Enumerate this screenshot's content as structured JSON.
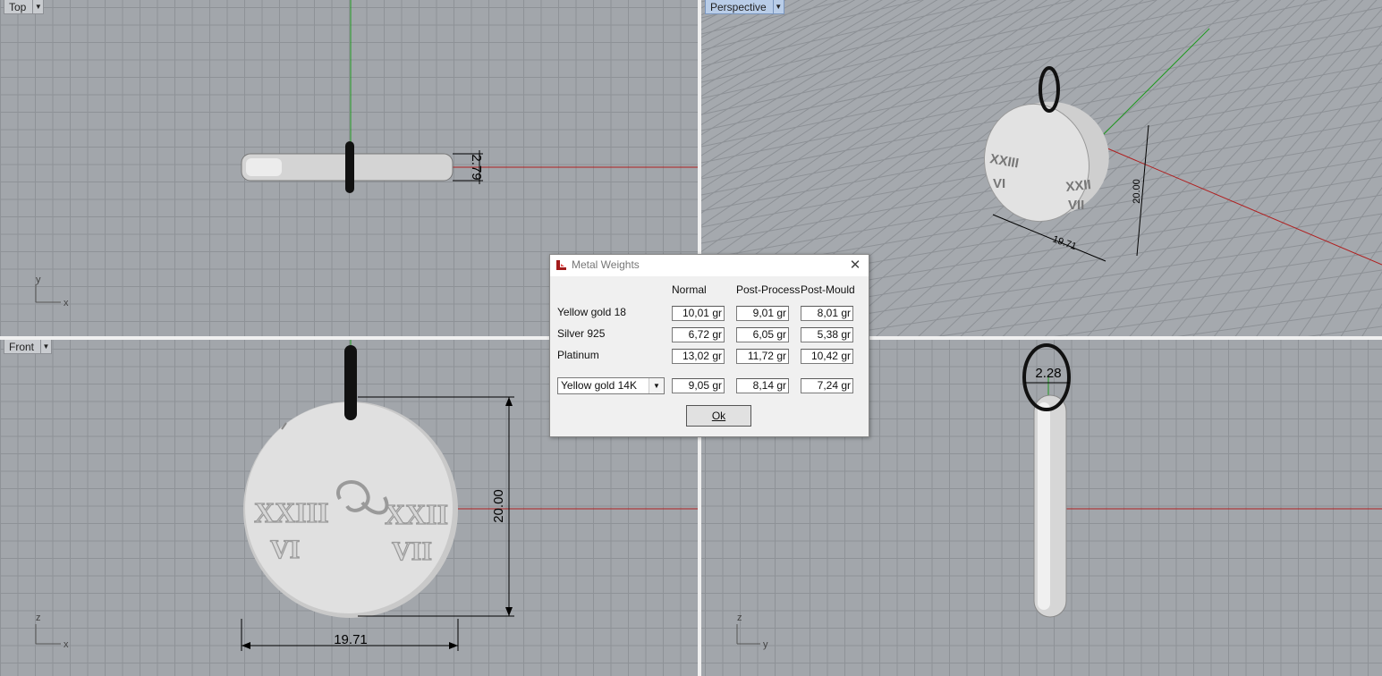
{
  "viewports": {
    "top": {
      "label": "Top",
      "axis_a": "y",
      "axis_b": "x",
      "dimension": "2.79"
    },
    "perspective": {
      "label": "Perspective",
      "dim_height": "20.00",
      "dim_width": "19.71"
    },
    "front": {
      "label": "Front",
      "axis_a": "z",
      "axis_b": "x",
      "dim_height": "20.00",
      "dim_width": "19.71"
    },
    "right": {
      "axis_a": "z",
      "axis_b": "y",
      "dimension": "2.28"
    }
  },
  "pendant_text": {
    "left_top": "XXIII",
    "left_bottom": "VI",
    "right_top": "XXII",
    "right_bottom": "VII"
  },
  "dialog": {
    "title": "Metal Weights",
    "columns": [
      "Normal",
      "Post-Process",
      "Post-Mould"
    ],
    "rows": [
      {
        "label": "Yellow gold 18",
        "values": [
          "10,01 gr",
          "9,01 gr",
          "8,01 gr"
        ]
      },
      {
        "label": "Silver 925",
        "values": [
          "6,72 gr",
          "6,05 gr",
          "5,38 gr"
        ]
      },
      {
        "label": "Platinum",
        "values": [
          "13,02 gr",
          "11,72 gr",
          "10,42 gr"
        ]
      }
    ],
    "custom_row": {
      "selected_metal": "Yellow gold 14K",
      "values": [
        "9,05 gr",
        "8,14 gr",
        "7,24 gr"
      ]
    },
    "ok_label": "Ok"
  },
  "colors": {
    "x_axis": "#b02020",
    "y_axis": "#1f9a1f",
    "selection_highlight": "#b9cde8"
  }
}
